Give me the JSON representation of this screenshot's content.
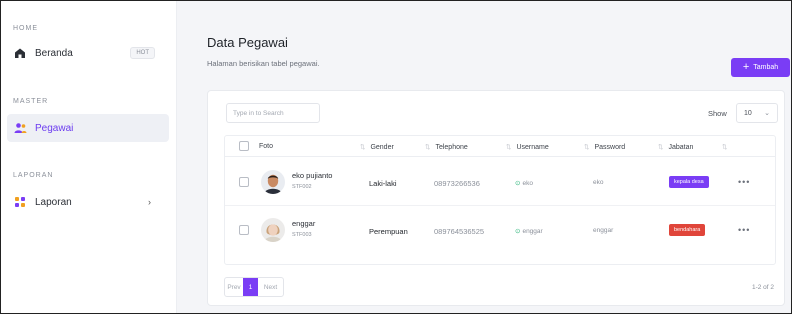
{
  "sidebar": {
    "home_title": "HOME",
    "master_title": "MASTER",
    "laporan_title": "LAPORAN",
    "items": [
      {
        "label": "Beranda",
        "badge": "HOT"
      },
      {
        "label": "Pegawai"
      },
      {
        "label": "Laporan"
      }
    ]
  },
  "header": {
    "title": "Data Pegawai",
    "subtitle": "Halaman berisikan tabel pegawai.",
    "add_label": "Tambah"
  },
  "table": {
    "search_placeholder": "Type in to Search",
    "show_label": "Show",
    "show_value": "10",
    "columns": [
      "Foto",
      "Gender",
      "Telephone",
      "Username",
      "Password",
      "Jabatan"
    ],
    "rows": [
      {
        "name": "eko pujianto",
        "nip": "STF002",
        "gender": "Laki-laki",
        "telephone": "08973266536",
        "username": "eko",
        "password": "eko",
        "jabatan": "kepala desa",
        "jabatan_color": "#7a3df5"
      },
      {
        "name": "enggar",
        "nip": "STF003",
        "gender": "Perempuan",
        "telephone": "089764536525",
        "username": "enggar",
        "password": "enggar",
        "jabatan": "bendahara",
        "jabatan_color": "#e0453a"
      }
    ],
    "pagination": {
      "prev": "Prev",
      "current": "1",
      "next": "Next",
      "range": "1-2 of 2"
    }
  },
  "colors": {
    "accent": "#7a3df5",
    "danger": "#e0453a",
    "success": "#2fb67c"
  },
  "icons": {
    "home": "home-icon",
    "users": "users-icon",
    "report": "report-icon",
    "more": "more-icon"
  }
}
